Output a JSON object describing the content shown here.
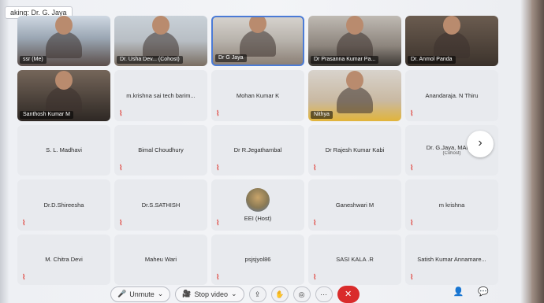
{
  "speaking": "aking: Dr. G. Jaya",
  "tiles": [
    {
      "name": "ssr (Me)",
      "kind": "video",
      "style": "v1",
      "muted": false
    },
    {
      "name": "Dr. Usha Dev... (Cohost)",
      "kind": "video",
      "style": "v2",
      "muted": false
    },
    {
      "name": "Dr G Jaya",
      "kind": "video",
      "style": "v3",
      "muted": false
    },
    {
      "name": "Dr Prasanna Kumar Pa...",
      "kind": "video",
      "style": "v4",
      "muted": false
    },
    {
      "name": "Dr. Anmol Panda",
      "kind": "video",
      "style": "v5",
      "muted": false
    },
    {
      "name": "Santhosh Kumar M",
      "kind": "video",
      "style": "v6",
      "muted": false
    },
    {
      "name": "m.krishna sai tech barim...",
      "kind": "name",
      "muted": true
    },
    {
      "name": "Mohan Kumar K",
      "kind": "name",
      "muted": true
    },
    {
      "name": "Nithya",
      "kind": "video",
      "style": "v7",
      "muted": false
    },
    {
      "name": "Anandaraja. N Thiru",
      "kind": "name",
      "muted": true
    },
    {
      "name": "S. L. Madhavi",
      "kind": "name",
      "muted": false
    },
    {
      "name": "Bimal Choudhury",
      "kind": "name",
      "muted": true
    },
    {
      "name": "Dr R.Jegathambal",
      "kind": "name",
      "muted": true
    },
    {
      "name": "Dr Rajesh Kumar Kabi",
      "kind": "name",
      "muted": true
    },
    {
      "name": "Dr. G.Jaya, MANI...",
      "sub": "(Cohost)",
      "kind": "name",
      "muted": true
    },
    {
      "name": "Dr.D.Shireesha",
      "kind": "name",
      "muted": true
    },
    {
      "name": "Dr.S.SATHISH",
      "kind": "name",
      "muted": true
    },
    {
      "name": "EEI (Host)",
      "kind": "host",
      "muted": true
    },
    {
      "name": "Ganeshwari M",
      "kind": "name",
      "muted": true
    },
    {
      "name": "m krishna",
      "kind": "name",
      "muted": true
    },
    {
      "name": "M. Chitra Devi",
      "kind": "name",
      "muted": true
    },
    {
      "name": "Maheu Wari",
      "kind": "name",
      "muted": false
    },
    {
      "name": "psjsjyol86",
      "kind": "name",
      "muted": true
    },
    {
      "name": "SASI KALA .R",
      "kind": "name",
      "muted": true
    },
    {
      "name": "Satish Kumar Annamare...",
      "kind": "name",
      "muted": true
    }
  ],
  "icons": {
    "mute": "muted-mic-icon",
    "next": "chevron-right-icon"
  },
  "next_glyph": "›",
  "toolbar": {
    "unmute_label": "Unmute",
    "stop_video_label": "Stop video",
    "share_glyph": "⇪",
    "reactions_glyph": "✋",
    "record_glyph": "◎",
    "more_glyph": "···",
    "end_glyph": "✕",
    "participants_glyph": "👤",
    "chat_glyph": "💬",
    "mute_glyph": "🎤",
    "video_glyph": "🎥",
    "caret": "⌄"
  },
  "colors": {
    "accent": "#4b7bd6",
    "end_call": "#d92b2b",
    "mute_red": "#e0443d"
  }
}
